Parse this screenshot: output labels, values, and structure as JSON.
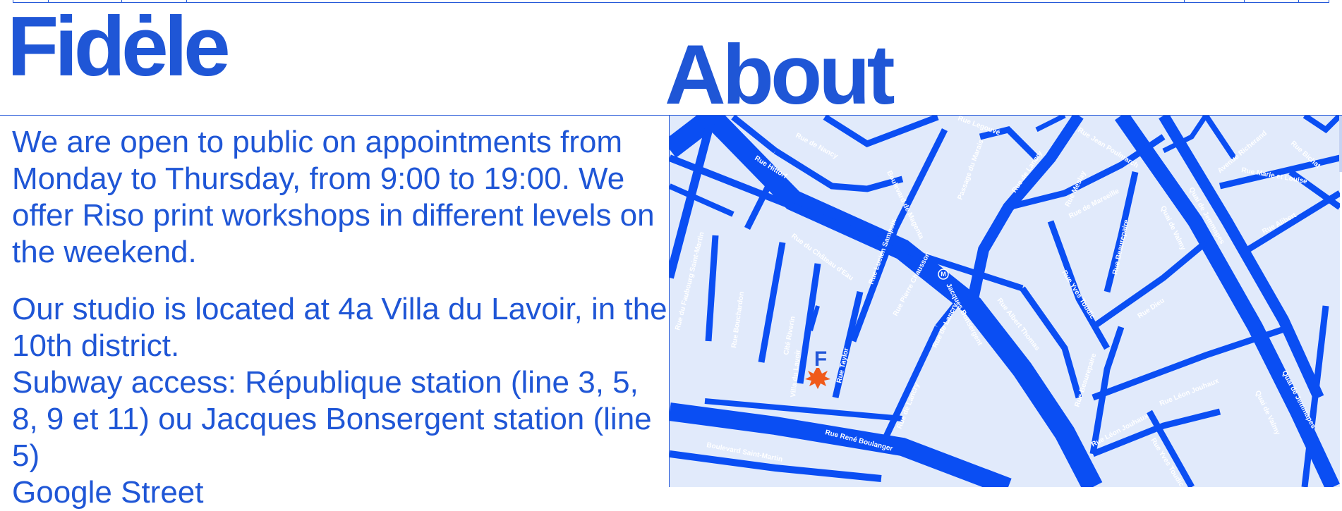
{
  "brand": {
    "name": "Fidėle"
  },
  "page": {
    "title": "About"
  },
  "about": {
    "p1": "We are open to public on appointments from Monday to Thursday, from 9:00 to 19:00. We offer Riso print workshops in different levels on the weekend.",
    "p2_line1": "Our studio is located at 4a Villa du Lavoir, in the 10th district.",
    "p2_line2": "Subway access: République station (line 3, 5, 8, 9 et 11) ou Jacques Bonsergent station (line 5)",
    "p2_line3": "Google Street"
  },
  "map": {
    "marker_letter": "F",
    "streets": {
      "rue_de_nancy": "Rue de Nancy",
      "rue_hittorf": "Rue Hittorf",
      "rue_du_faubourg_saint_martin": "Rue du Faubourg Saint-Martin",
      "rue_du_chateau_deau": "Rue du Château d'Eau",
      "rue_bouchardon": "Rue Bouchardon",
      "cite_riverin": "Cité Riverin",
      "villa_du_lavoir": "Villa du Lavoir",
      "rue_taylor": "Rue Taylor",
      "boulevard_de_magenta": "Boulevard de Magenta",
      "rue_lucien_sampaix": "Rue Lucien Sampaix",
      "rue_pierre_chausson": "Rue Pierre Chausson",
      "rue_de_lancry_1": "Rue de Lancry",
      "rue_de_lancry_2": "Rue de Lancry",
      "rue_de_lancry_3": "Rue de Lancry",
      "jacques_bonsergent": "Jacques Bonsergent",
      "rue_albert_thomas": "Rue Albert Thomas",
      "rue_yves_toudic_1": "Rue Yves Toudic",
      "rue_yves_toudic_2": "Rue Yves Toudic",
      "rue_beaurepaire_1": "Rue Beaurepaire",
      "rue_beaurepaire_2": "Rue Beaurepaire",
      "rue_de_marseille": "Rue de Marseille",
      "rue_dieu": "Rue Dieu",
      "quai_de_jemmapes_1": "Quai de Jemmapes",
      "quai_de_jemmapes_2": "Quai de Jemmapes",
      "quai_de_valmy_1": "Quai de Valmy",
      "quai_de_valmy_2": "Quai de Valmy",
      "rue_jean_poulmarch": "Rue Jean Poulmarch",
      "avenue_richerand": "Avenue Richerand",
      "rue_bichat": "Rue Bichat",
      "rue_marie_et_louise": "Rue Marie et Louise",
      "rue_alibert": "Rue Alibert",
      "rue_leon_jouhaux_1": "Rue Léon Jouhaux",
      "rue_leon_jouhaux_2": "Rue Léon Jouhaux",
      "boulevard_saint_martin": "Boulevard Saint-Martin",
      "rue_rene_boulanger": "Rue René Boulanger",
      "rue_legouve": "Rue Legouvé",
      "rue_du_marais": "Passage du Marais",
      "rue_meslay": "Rue Meslay",
      "metro_symbol": "M"
    }
  },
  "colors": {
    "accent": "#1f56d6",
    "map_background": "#e1eafb",
    "street": "#0a4ef3",
    "marker": "#f05a1a"
  }
}
